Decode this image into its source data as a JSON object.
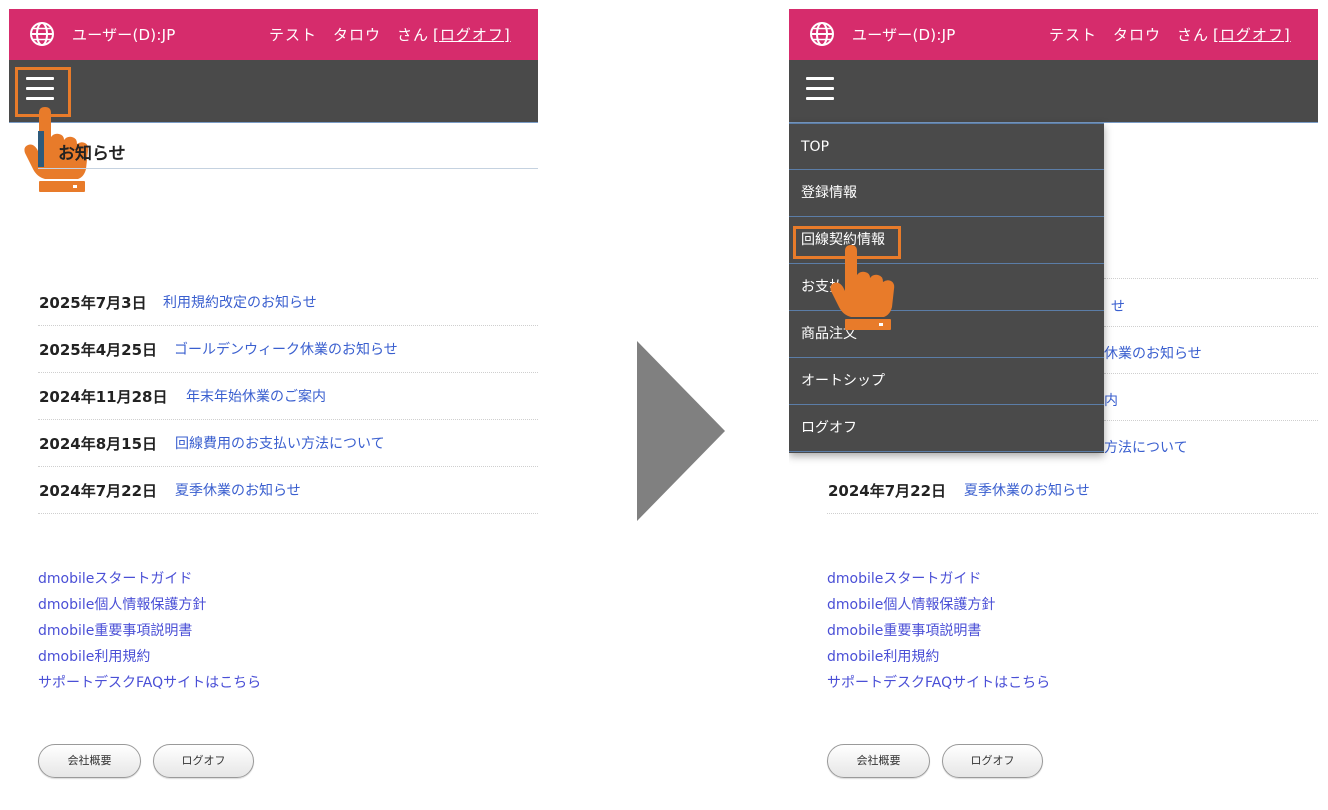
{
  "header": {
    "user_label": "ユーザー(D):JP",
    "user_name": "テスト　タロウ　さん",
    "logoff_link": "[ログオフ]"
  },
  "section": {
    "title": "お知らせ"
  },
  "news": [
    {
      "date": "2025年7月3日",
      "title": "利用規約改定のお知らせ"
    },
    {
      "date": "2025年4月25日",
      "title": "ゴールデンウィーク休業のお知らせ"
    },
    {
      "date": "2024年11月28日",
      "title": "年末年始休業のご案内"
    },
    {
      "date": "2024年8月15日",
      "title": "回線費用のお支払い方法について"
    },
    {
      "date": "2024年7月22日",
      "title": "夏季休業のお知らせ"
    }
  ],
  "footer_links": [
    "dmobileスタートガイド",
    "dmobile個人情報保護方針",
    "dmobile重要事項説明書",
    "dmobile利用規約",
    "サポートデスクFAQサイトはこちら"
  ],
  "buttons": {
    "company": "会社概要",
    "logoff": "ログオフ"
  },
  "menu": {
    "items": [
      "TOP",
      "登録情報",
      "回線契約情報",
      "お支払",
      "商品注文",
      "オートシップ",
      "ログオフ"
    ]
  },
  "right_visible": {
    "news_fragments": [
      "せ",
      "休業のお知らせ",
      "内",
      "方法について"
    ],
    "news_last_date": "2024年7月22日",
    "news_last_title": "夏季休業のお知らせ"
  },
  "colors": {
    "topbar": "#d62c6c",
    "navbar": "#4a4a4a",
    "accent_orange": "#e87b2a",
    "link_blue": "#3a5fcf",
    "section_bar": "#2d5a7b",
    "arrow_gray": "#808080"
  },
  "icons": {
    "globe": "globe-icon",
    "menu": "hamburger-menu-icon",
    "pointer": "pointing-hand-icon",
    "arrow": "next-step-arrow-icon"
  }
}
